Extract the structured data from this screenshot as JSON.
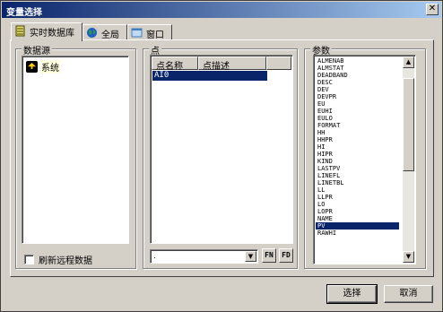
{
  "window": {
    "title": "变量选择",
    "close_glyph": "✕"
  },
  "tabs": [
    {
      "label": "实时数据库",
      "icon": "database-icon"
    },
    {
      "label": "全局",
      "icon": "globe-icon"
    },
    {
      "label": "窗口",
      "icon": "window-icon"
    }
  ],
  "datasource": {
    "label": "数据源",
    "tree_item": "系统",
    "checkbox_label": "刷新远程数据"
  },
  "points": {
    "label": "点",
    "columns": [
      "点名称",
      "点描述"
    ],
    "selected_row": "AI0",
    "combo_value": ".",
    "fn_button": "FN",
    "fd_button": "FD"
  },
  "params": {
    "label": "参数",
    "items": [
      "ALMENAB",
      "ALMSTAT",
      "DEADBAND",
      "DESC",
      "DEV",
      "DEVPR",
      "EU",
      "EUHI",
      "EULO",
      "FORMAT",
      "HH",
      "HHPR",
      "HI",
      "HIPR",
      "KIND",
      "LASTPV",
      "LINEFL",
      "LINETBL",
      "LL",
      "LLPR",
      "LO",
      "LOPR",
      "NAME",
      "PV",
      "RAWHI"
    ],
    "selected": "PV"
  },
  "buttons": {
    "select": "选择",
    "cancel": "取消"
  },
  "colors": {
    "selection": "#0a246a",
    "title_start": "#0a246a",
    "title_end": "#a6caf0",
    "face": "#d4d0c8"
  }
}
